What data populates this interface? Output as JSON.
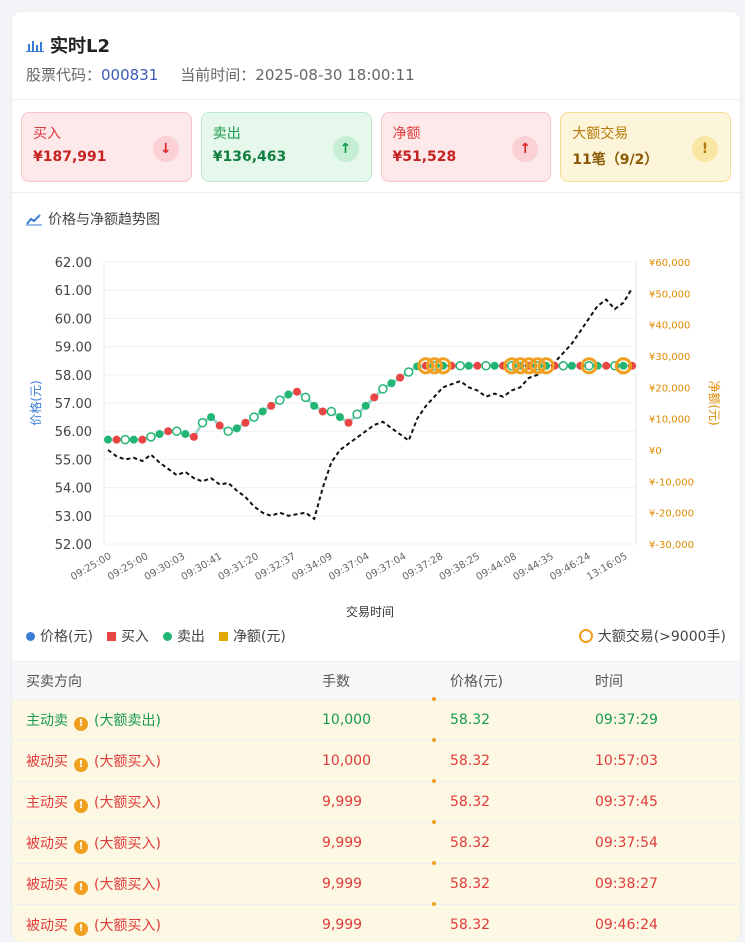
{
  "header": {
    "title": "实时L2",
    "code_label": "股票代码：",
    "code": "000831",
    "time_label": "当前时间：",
    "time": "2025-08-30 18:00:11"
  },
  "stats": [
    {
      "label": "买入",
      "value": "¥187,991",
      "icon": "arrow-down-icon"
    },
    {
      "label": "卖出",
      "value": "¥136,463",
      "icon": "arrow-up-icon"
    },
    {
      "label": "净额",
      "value": "¥51,528",
      "icon": "arrow-up-icon"
    },
    {
      "label": "大额交易",
      "value": "11笔（9/2）",
      "icon": "warning-icon"
    }
  ],
  "chart_title": "价格与净额趋势图",
  "chart_data": {
    "type": "line",
    "xlabel": "交易时间",
    "ylabel_left": "价格(元)",
    "ylabel_right": "净额(元)",
    "ylim_left": [
      52,
      62
    ],
    "ylim_right": [
      -30000,
      60000
    ],
    "yticks_left": [
      "62.00",
      "61.00",
      "60.00",
      "59.00",
      "58.00",
      "57.00",
      "56.00",
      "55.00",
      "54.00",
      "53.00",
      "52.00"
    ],
    "yticks_right": [
      "¥60,000",
      "¥50,000",
      "¥40,000",
      "¥30,000",
      "¥20,000",
      "¥10,000",
      "¥0",
      "¥-10,000",
      "¥-20,000",
      "¥-30,000"
    ],
    "xticks": [
      "09:25:00",
      "09:25:00",
      "09:30:03",
      "09:30:41",
      "09:31:20",
      "09:32:37",
      "09:34:09",
      "09:37:04",
      "09:37:04",
      "09:37:28",
      "09:38:25",
      "09:44:08",
      "09:44:35",
      "09:46:24",
      "13:16:05"
    ],
    "price": [
      55.7,
      55.7,
      55.7,
      55.7,
      55.7,
      55.8,
      55.9,
      56.0,
      56.0,
      55.9,
      55.8,
      56.3,
      56.5,
      56.2,
      56.0,
      56.1,
      56.3,
      56.5,
      56.7,
      56.9,
      57.1,
      57.3,
      57.4,
      57.2,
      56.9,
      56.7,
      56.7,
      56.5,
      56.3,
      56.6,
      56.9,
      57.2,
      57.5,
      57.7,
      57.9,
      58.1,
      58.3,
      58.32,
      58.32,
      58.32,
      58.32,
      58.32,
      58.32,
      58.32,
      58.32,
      58.32,
      58.32,
      58.32,
      58.32,
      58.32,
      58.32,
      58.32,
      58.32,
      58.32,
      58.32,
      58.32,
      58.32,
      58.32,
      58.32,
      58.32,
      58.32,
      58.32
    ],
    "net": [
      0,
      -2000,
      -3000,
      -2500,
      -3500,
      -1500,
      -4000,
      -6000,
      -8000,
      -7000,
      -9000,
      -10000,
      -9000,
      -11000,
      -10500,
      -13000,
      -15000,
      -18000,
      -20000,
      -21000,
      -20000,
      -21000,
      -20500,
      -20000,
      -22000,
      -12000,
      -4000,
      0,
      2000,
      4000,
      6000,
      8000,
      9000,
      7000,
      5000,
      3000,
      10000,
      14000,
      17000,
      20000,
      21000,
      22000,
      20000,
      19000,
      17000,
      18000,
      17000,
      19000,
      20000,
      23000,
      24000,
      26000,
      28000,
      31000,
      34000,
      38000,
      42000,
      46000,
      48000,
      45000,
      47000,
      51528
    ],
    "big_trades_price": 58.32,
    "big_trades_count": 11,
    "series": [
      {
        "name": "价格(元)",
        "color": "#3a7bd5"
      },
      {
        "name": "买入",
        "color": "#e84545"
      },
      {
        "name": "卖出",
        "color": "#22b573"
      },
      {
        "name": "净额(元)",
        "color": "#e0a800"
      }
    ]
  },
  "legend": {
    "items": [
      "价格(元)",
      "买入",
      "卖出",
      "净额(元)"
    ],
    "big_trade": "大额交易(>9000手)"
  },
  "table": {
    "headers": [
      "买卖方向",
      "手数",
      "价格(元)",
      "时间"
    ],
    "rows": [
      {
        "direction": "主动卖",
        "tag": "(大额卖出)",
        "lots": "10,000",
        "price": "58.32",
        "time": "09:37:29",
        "color": "green"
      },
      {
        "direction": "被动买",
        "tag": "(大额买入)",
        "lots": "10,000",
        "price": "58.32",
        "time": "10:57:03",
        "color": "red"
      },
      {
        "direction": "主动买",
        "tag": "(大额买入)",
        "lots": "9,999",
        "price": "58.32",
        "time": "09:37:45",
        "color": "red"
      },
      {
        "direction": "被动买",
        "tag": "(大额买入)",
        "lots": "9,999",
        "price": "58.32",
        "time": "09:37:54",
        "color": "red"
      },
      {
        "direction": "被动买",
        "tag": "(大额买入)",
        "lots": "9,999",
        "price": "58.32",
        "time": "09:38:27",
        "color": "red"
      },
      {
        "direction": "被动买",
        "tag": "(大额买入)",
        "lots": "9,999",
        "price": "58.32",
        "time": "09:46:24",
        "color": "red"
      }
    ]
  }
}
